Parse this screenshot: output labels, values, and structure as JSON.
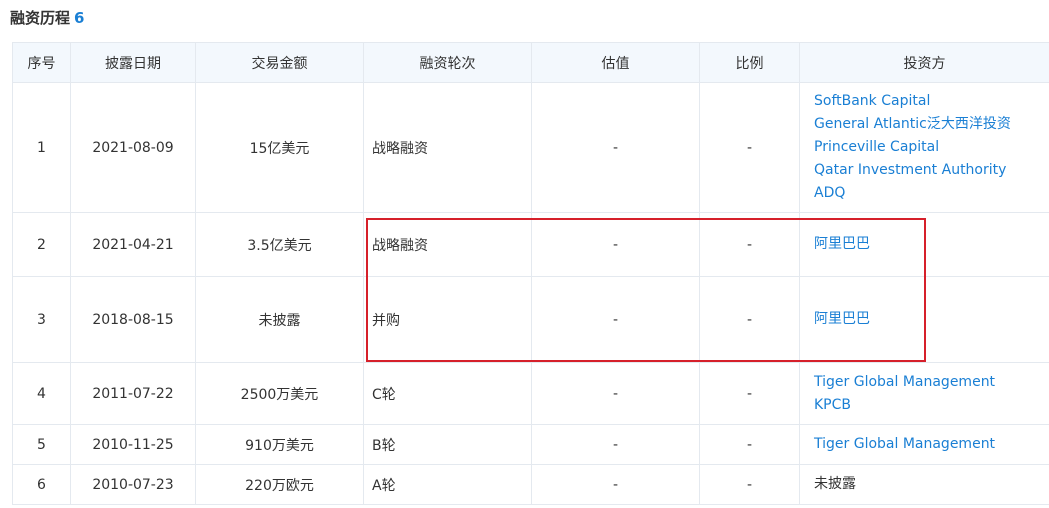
{
  "section": {
    "title": "融资历程",
    "count": "6"
  },
  "table": {
    "headers": [
      "序号",
      "披露日期",
      "交易金额",
      "融资轮次",
      "估值",
      "比例",
      "投资方"
    ],
    "rows": [
      {
        "no": "1",
        "date": "2021-08-09",
        "amount": "15亿美元",
        "round": "战略融资",
        "valuation": "-",
        "ratio": "-",
        "investors": [
          {
            "name": "SoftBank Capital",
            "link": true
          },
          {
            "name": "General Atlantic泛大西洋投资",
            "link": true
          },
          {
            "name": "Princeville Capital",
            "link": true
          },
          {
            "name": "Qatar Investment Authority",
            "link": true
          },
          {
            "name": "ADQ",
            "link": true
          }
        ]
      },
      {
        "no": "2",
        "date": "2021-04-21",
        "amount": "3.5亿美元",
        "round": "战略融资",
        "valuation": "-",
        "ratio": "-",
        "investors": [
          {
            "name": "阿里巴巴",
            "link": true
          }
        ]
      },
      {
        "no": "3",
        "date": "2018-08-15",
        "amount": "未披露",
        "round": "并购",
        "valuation": "-",
        "ratio": "-",
        "investors": [
          {
            "name": "阿里巴巴",
            "link": true
          }
        ]
      },
      {
        "no": "4",
        "date": "2011-07-22",
        "amount": "2500万美元",
        "round": "C轮",
        "valuation": "-",
        "ratio": "-",
        "investors": [
          {
            "name": "Tiger Global Management",
            "link": true
          },
          {
            "name": "KPCB",
            "link": true
          }
        ]
      },
      {
        "no": "5",
        "date": "2010-11-25",
        "amount": "910万美元",
        "round": "B轮",
        "valuation": "-",
        "ratio": "-",
        "investors": [
          {
            "name": "Tiger Global Management",
            "link": true
          }
        ]
      },
      {
        "no": "6",
        "date": "2010-07-23",
        "amount": "220万欧元",
        "round": "A轮",
        "valuation": "-",
        "ratio": "-",
        "investors": [
          {
            "name": "未披露",
            "link": false
          }
        ]
      }
    ]
  },
  "highlight_color": "#d6202a",
  "link_color": "#1a7fd4"
}
